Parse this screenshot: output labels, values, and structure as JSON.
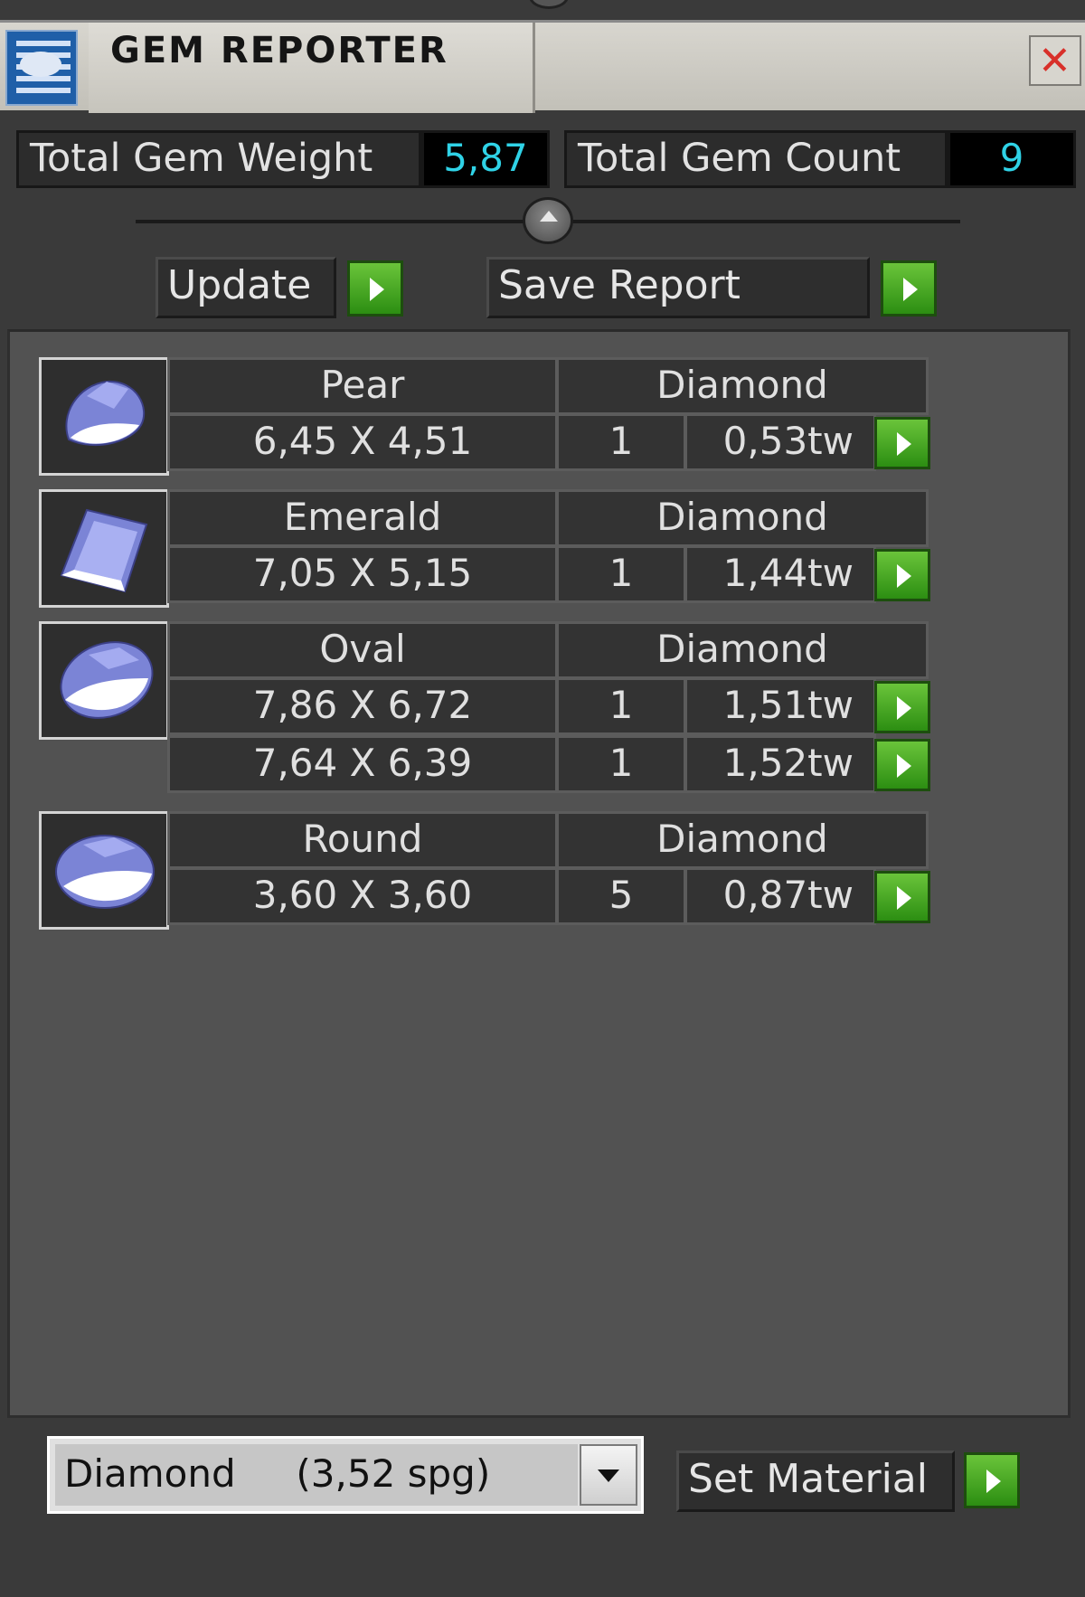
{
  "window": {
    "title": "GEM REPORTER",
    "close_symbol": "✕",
    "app_icon": "gem-report-icon"
  },
  "stats": {
    "weight_label": "Total Gem Weight",
    "weight_value": "5,87",
    "count_label": "Total Gem Count",
    "count_value": "9"
  },
  "actions": {
    "update_label": "Update",
    "save_label": "Save Report"
  },
  "gems": [
    {
      "shape": "Pear",
      "material": "Diamond",
      "rows": [
        {
          "size": "6,45 X 4,51",
          "count": "1",
          "weight": "0,53tw"
        }
      ]
    },
    {
      "shape": "Emerald",
      "material": "Diamond",
      "rows": [
        {
          "size": "7,05 X 5,15",
          "count": "1",
          "weight": "1,44tw"
        }
      ]
    },
    {
      "shape": "Oval",
      "material": "Diamond",
      "rows": [
        {
          "size": "7,86 X 6,72",
          "count": "1",
          "weight": "1,51tw"
        },
        {
          "size": "7,64 X 6,39",
          "count": "1",
          "weight": "1,52tw"
        }
      ]
    },
    {
      "shape": "Round",
      "material": "Diamond",
      "rows": [
        {
          "size": "3,60 X 3,60",
          "count": "5",
          "weight": "0,87tw"
        }
      ]
    }
  ],
  "material_select": {
    "selected": "Diamond     (3,52 spg)"
  },
  "set_material_label": "Set Material",
  "colors": {
    "accent_cyan": "#2fd2e6",
    "go_green": "#3aa81e",
    "gem_blue": "#7b84d6"
  }
}
